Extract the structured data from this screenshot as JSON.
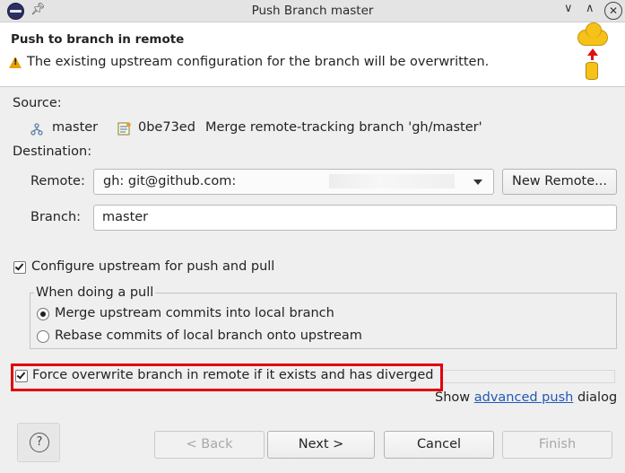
{
  "window": {
    "title": "Push Branch master"
  },
  "banner": {
    "heading": "Push to branch in remote",
    "warning": "The existing upstream configuration for the branch will be overwritten."
  },
  "source": {
    "label": "Source:",
    "branch": "master",
    "commit_id": "0be73ed",
    "commit_message": "Merge remote-tracking branch 'gh/master'"
  },
  "destination": {
    "label": "Destination:",
    "remote_label": "Remote:",
    "remote_value": "gh: git@github.com:",
    "new_remote_button": "New Remote...",
    "branch_label": "Branch:",
    "branch_value": "master"
  },
  "upstream": {
    "configure_label": "Configure upstream for push and pull",
    "configure_checked": true,
    "group_title": "When doing a pull",
    "options": [
      {
        "label": "Merge upstream commits into local branch",
        "selected": true
      },
      {
        "label": "Rebase commits of local branch onto upstream",
        "selected": false
      }
    ]
  },
  "force": {
    "label": "Force overwrite branch in remote if it exists and has diverged",
    "checked": true
  },
  "advanced": {
    "prefix": "Show",
    "link": "advanced push",
    "suffix": "dialog"
  },
  "footer": {
    "help_glyph": "?",
    "back": "< Back",
    "next": "Next >",
    "cancel": "Cancel",
    "finish": "Finish"
  },
  "colors": {
    "highlight_border": "#e0000e",
    "link": "#2158b5"
  }
}
